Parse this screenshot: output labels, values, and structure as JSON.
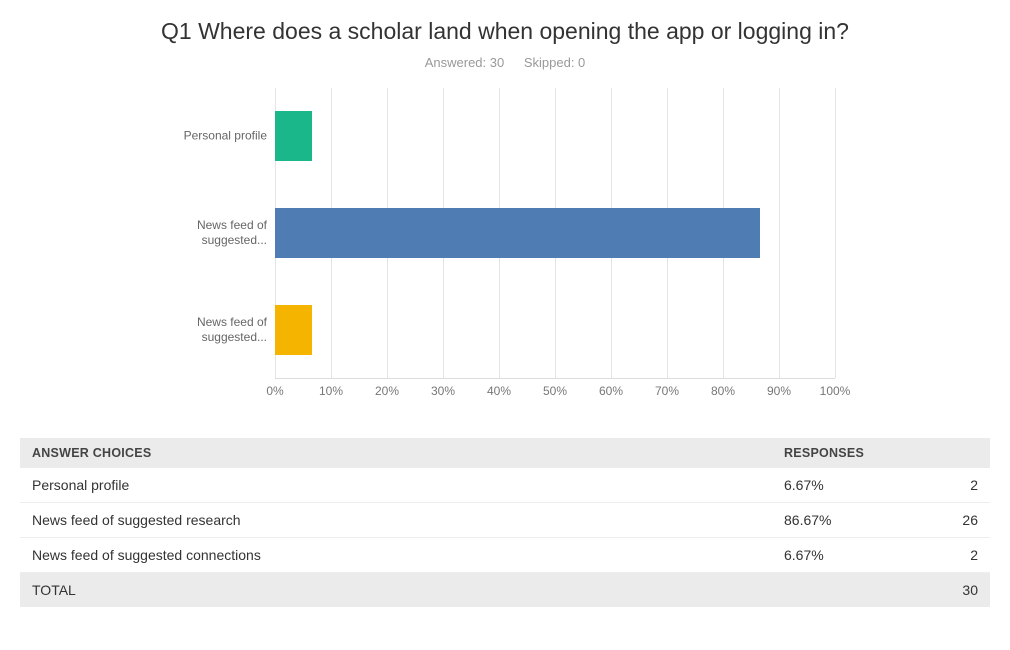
{
  "title": "Q1 Where does a scholar land when opening the app or logging in?",
  "meta": {
    "answered_label": "Answered: 30",
    "skipped_label": "Skipped: 0"
  },
  "table": {
    "header_answer": "ANSWER CHOICES",
    "header_responses": "RESPONSES",
    "rows": [
      {
        "label": "Personal profile",
        "pct": "6.67%",
        "count": "2"
      },
      {
        "label": "News feed of suggested research",
        "pct": "86.67%",
        "count": "26"
      },
      {
        "label": "News feed of suggested connections",
        "pct": "6.67%",
        "count": "2"
      }
    ],
    "total_label": "TOTAL",
    "total_count": "30"
  },
  "chart_data": {
    "type": "bar",
    "orientation": "horizontal",
    "title": "Q1 Where does a scholar land when opening the app or logging in?",
    "xlabel": "",
    "ylabel": "",
    "x_ticks": [
      "0%",
      "10%",
      "20%",
      "30%",
      "40%",
      "50%",
      "60%",
      "70%",
      "80%",
      "90%",
      "100%"
    ],
    "xlim": [
      0,
      100
    ],
    "categories": [
      "Personal profile",
      "News feed of suggested...",
      "News feed of suggested..."
    ],
    "categories_full": [
      "Personal profile",
      "News feed of suggested research",
      "News feed of suggested connections"
    ],
    "values": [
      6.67,
      86.67,
      6.67
    ],
    "colors": [
      "#1ab78a",
      "#507cb4",
      "#f5b400"
    ]
  }
}
